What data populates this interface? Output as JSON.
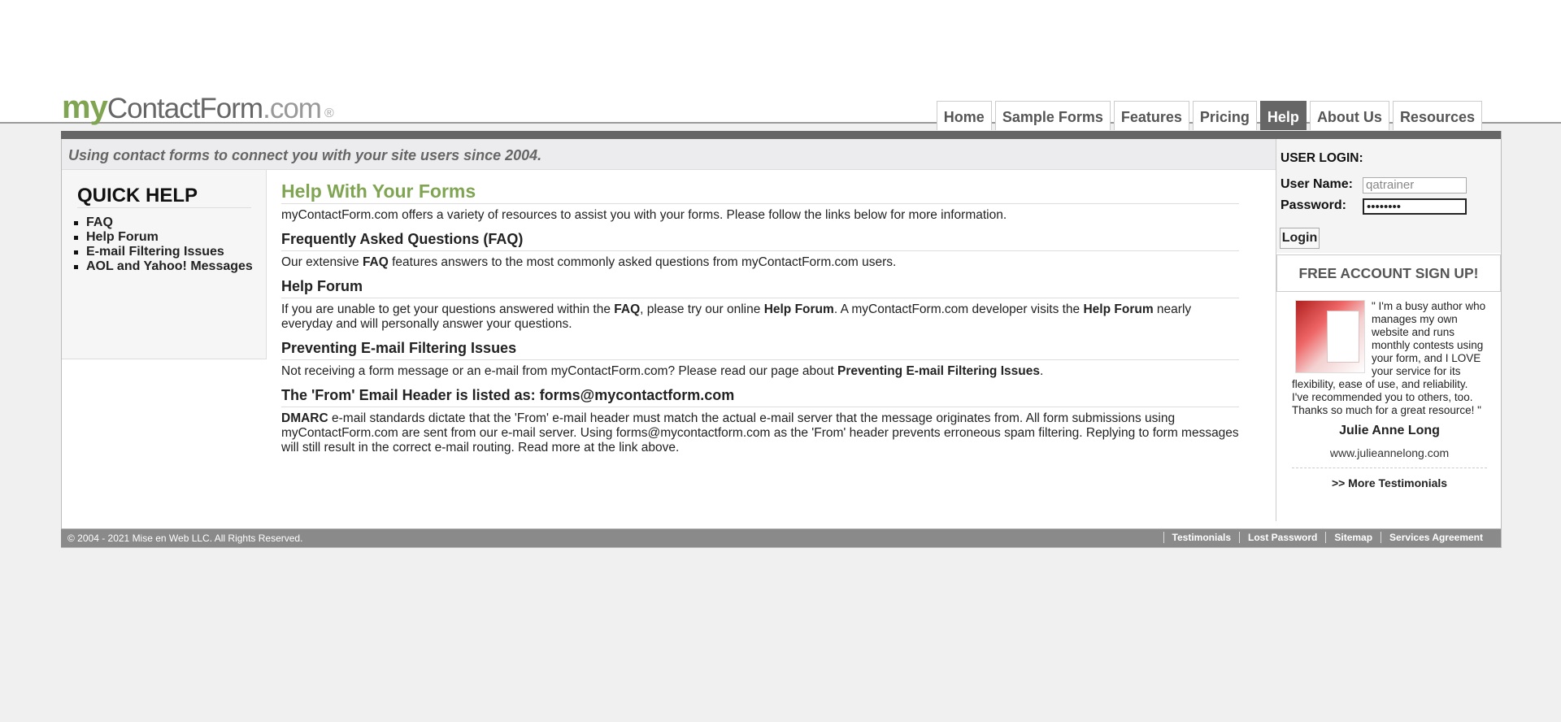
{
  "logo": {
    "my": "my",
    "contact_form": "ContactForm",
    "dotcom": ".com",
    "reg": "®"
  },
  "nav": {
    "tabs": [
      "Home",
      "Sample Forms",
      "Features",
      "Pricing",
      "Help",
      "About Us",
      "Resources"
    ],
    "active": "Help"
  },
  "tagline": "Using contact forms to connect you with your site users since 2004.",
  "quick_help": {
    "title": "QUICK HELP",
    "items": [
      "FAQ",
      "Help Forum",
      "E-mail Filtering Issues",
      "AOL and Yahoo! Messages"
    ]
  },
  "main": {
    "title": "Help With Your Forms",
    "intro": "myContactForm.com offers a variety of resources to assist you with your forms. Please follow the links below for more information.",
    "sections": {
      "faq": {
        "title": "Frequently Asked Questions (FAQ)",
        "text_a": "Our extensive ",
        "bold_a": "FAQ",
        "text_b": " features answers to the most commonly asked questions from myContactForm.com users."
      },
      "forum": {
        "title": "Help Forum",
        "text_a": "If you are unable to get your questions answered within the ",
        "bold_a": "FAQ",
        "text_b": ", please try our online ",
        "bold_b": "Help Forum",
        "text_c": ". A myContactForm.com developer visits the ",
        "bold_c": "Help Forum",
        "text_d": " nearly everyday and will personally answer your questions."
      },
      "filtering": {
        "title": "Preventing E-mail Filtering Issues",
        "text_a": "Not receiving a form message or an e-mail from myContactForm.com? Please read our page about ",
        "bold_a": "Preventing E-mail Filtering Issues",
        "text_b": "."
      },
      "from_header": {
        "title": "The 'From' Email Header is listed as: forms@mycontactform.com",
        "bold_a": "DMARC",
        "text_a": " e-mail standards dictate that the 'From' e-mail header must match the actual e-mail server that the message originates from. All form submissions using myContactForm.com are sent from our e-mail server. Using forms@mycontactform.com as the 'From' header prevents erroneous spam filtering. Replying to form messages will still result in the correct e-mail routing. Read more at the link above."
      }
    }
  },
  "login": {
    "title": "USER LOGIN:",
    "username_label": "User Name:",
    "username_value": "qatrainer",
    "password_label": "Password:",
    "password_value": "••••••••",
    "button": "Login"
  },
  "signup": "FREE ACCOUNT SIGN UP!",
  "testimonial": {
    "quote": "\" I'm a busy author who manages my own website and runs monthly contests using your form, and I LOVE your service for its flexibility, ease of use, and reliability. I've recommended you to others, too. Thanks so much for a great resource! \"",
    "author": "Julie Anne Long",
    "url": "www.julieannelong.com",
    "more": ">> More Testimonials"
  },
  "footer": {
    "copyright": "© 2004 - 2021 Mise en Web LLC. All Rights Reserved.",
    "links": [
      "Testimonials",
      "Lost Password",
      "Sitemap",
      "Services Agreement"
    ]
  }
}
